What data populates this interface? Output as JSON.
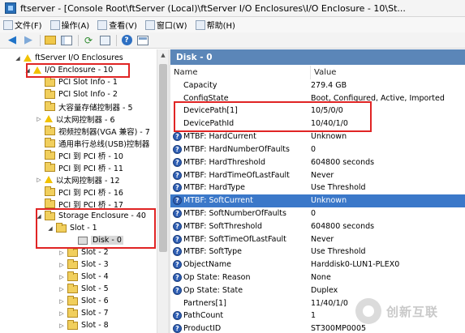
{
  "window": {
    "title": "ftserver - [Console Root\\ftServer (Local)\\ftServer I/O Enclosures\\I/O Enclosure - 10\\St..."
  },
  "menu": [
    {
      "label": "文件(F)",
      "icon": "file-menu-icon"
    },
    {
      "label": "操作(A)",
      "icon": "action-menu-icon"
    },
    {
      "label": "查看(V)",
      "icon": "view-menu-icon"
    },
    {
      "label": "窗口(W)",
      "icon": "window-menu-icon"
    },
    {
      "label": "帮助(H)",
      "icon": "help-menu-icon"
    }
  ],
  "tree": [
    {
      "label": "ftServer I/O Enclosures",
      "icon": "warning",
      "expander": "expanded"
    },
    {
      "label": "I/O Enclosure - 10",
      "icon": "warning",
      "expander": "expanded"
    },
    {
      "label": "PCI Slot Info - 1",
      "icon": "folder",
      "expander": "none"
    },
    {
      "label": "PCI Slot Info - 2",
      "icon": "folder",
      "expander": "none"
    },
    {
      "label": "大容量存储控制器 - 5",
      "icon": "folder",
      "expander": "none"
    },
    {
      "label": "以太网控制器 - 6",
      "icon": "warning",
      "expander": "collapsed"
    },
    {
      "label": "视频控制器(VGA 兼容) - 7",
      "icon": "folder",
      "expander": "none"
    },
    {
      "label": "通用串行总线(USB)控制器",
      "icon": "folder",
      "expander": "none"
    },
    {
      "label": "PCI 到 PCI 桥 - 10",
      "icon": "folder",
      "expander": "none"
    },
    {
      "label": "PCI 到 PCI 桥 - 11",
      "icon": "folder",
      "expander": "none"
    },
    {
      "label": "以太网控制器 - 12",
      "icon": "warning",
      "expander": "collapsed"
    },
    {
      "label": "PCI 到 PCI 桥 - 16",
      "icon": "folder",
      "expander": "none"
    },
    {
      "label": "PCI 到 PCI 桥 - 17",
      "icon": "folder",
      "expander": "none"
    },
    {
      "label": "Storage Enclosure - 40",
      "icon": "folder",
      "expander": "expanded"
    },
    {
      "label": "Slot - 1",
      "icon": "folder",
      "expander": "expanded"
    },
    {
      "label": "Disk - 0",
      "icon": "disk",
      "expander": "none",
      "selected": true
    },
    {
      "label": "Slot - 2",
      "icon": "folder",
      "expander": "collapsed"
    },
    {
      "label": "Slot - 3",
      "icon": "folder",
      "expander": "collapsed"
    },
    {
      "label": "Slot - 4",
      "icon": "folder",
      "expander": "collapsed"
    },
    {
      "label": "Slot - 5",
      "icon": "folder",
      "expander": "collapsed"
    },
    {
      "label": "Slot - 6",
      "icon": "folder",
      "expander": "collapsed"
    },
    {
      "label": "Slot - 7",
      "icon": "folder",
      "expander": "collapsed"
    },
    {
      "label": "Slot - 8",
      "icon": "folder",
      "expander": "collapsed"
    }
  ],
  "detail": {
    "header": "Disk - 0",
    "columns": {
      "name": "Name",
      "value": "Value"
    },
    "rows": [
      {
        "name": "Capacity",
        "value": "279.4 GB",
        "info": false
      },
      {
        "name": "ConfigState",
        "value": "Boot, Configured, Active, Imported",
        "info": false
      },
      {
        "name": "DevicePath[1]",
        "value": "10/5/0/0",
        "info": false
      },
      {
        "name": "DevicePathId",
        "value": "10/40/1/0",
        "info": false
      },
      {
        "name": "MTBF: HardCurrent",
        "value": "Unknown",
        "info": true
      },
      {
        "name": "MTBF: HardNumberOfFaults",
        "value": "0",
        "info": true
      },
      {
        "name": "MTBF: HardThreshold",
        "value": "604800 seconds",
        "info": true
      },
      {
        "name": "MTBF: HardTimeOfLastFault",
        "value": "Never",
        "info": true
      },
      {
        "name": "MTBF: HardType",
        "value": "Use Threshold",
        "info": true
      },
      {
        "name": "MTBF: SoftCurrent",
        "value": "Unknown",
        "info": true,
        "selected": true
      },
      {
        "name": "MTBF: SoftNumberOfFaults",
        "value": "0",
        "info": true
      },
      {
        "name": "MTBF: SoftThreshold",
        "value": "604800 seconds",
        "info": true
      },
      {
        "name": "MTBF: SoftTimeOfLastFault",
        "value": "Never",
        "info": true
      },
      {
        "name": "MTBF: SoftType",
        "value": "Use Threshold",
        "info": true
      },
      {
        "name": "ObjectName",
        "value": "Harddisk0-LUN1-PLEX0",
        "info": true
      },
      {
        "name": "Op State: Reason",
        "value": "None",
        "info": true
      },
      {
        "name": "Op State: State",
        "value": "Duplex",
        "info": true
      },
      {
        "name": "Partners[1]",
        "value": "11/40/1/0",
        "info": false
      },
      {
        "name": "PathCount",
        "value": "1",
        "info": true
      },
      {
        "name": "ProductID",
        "value": "ST300MP0005",
        "info": true
      }
    ]
  },
  "watermark": {
    "text": "创新互联"
  }
}
